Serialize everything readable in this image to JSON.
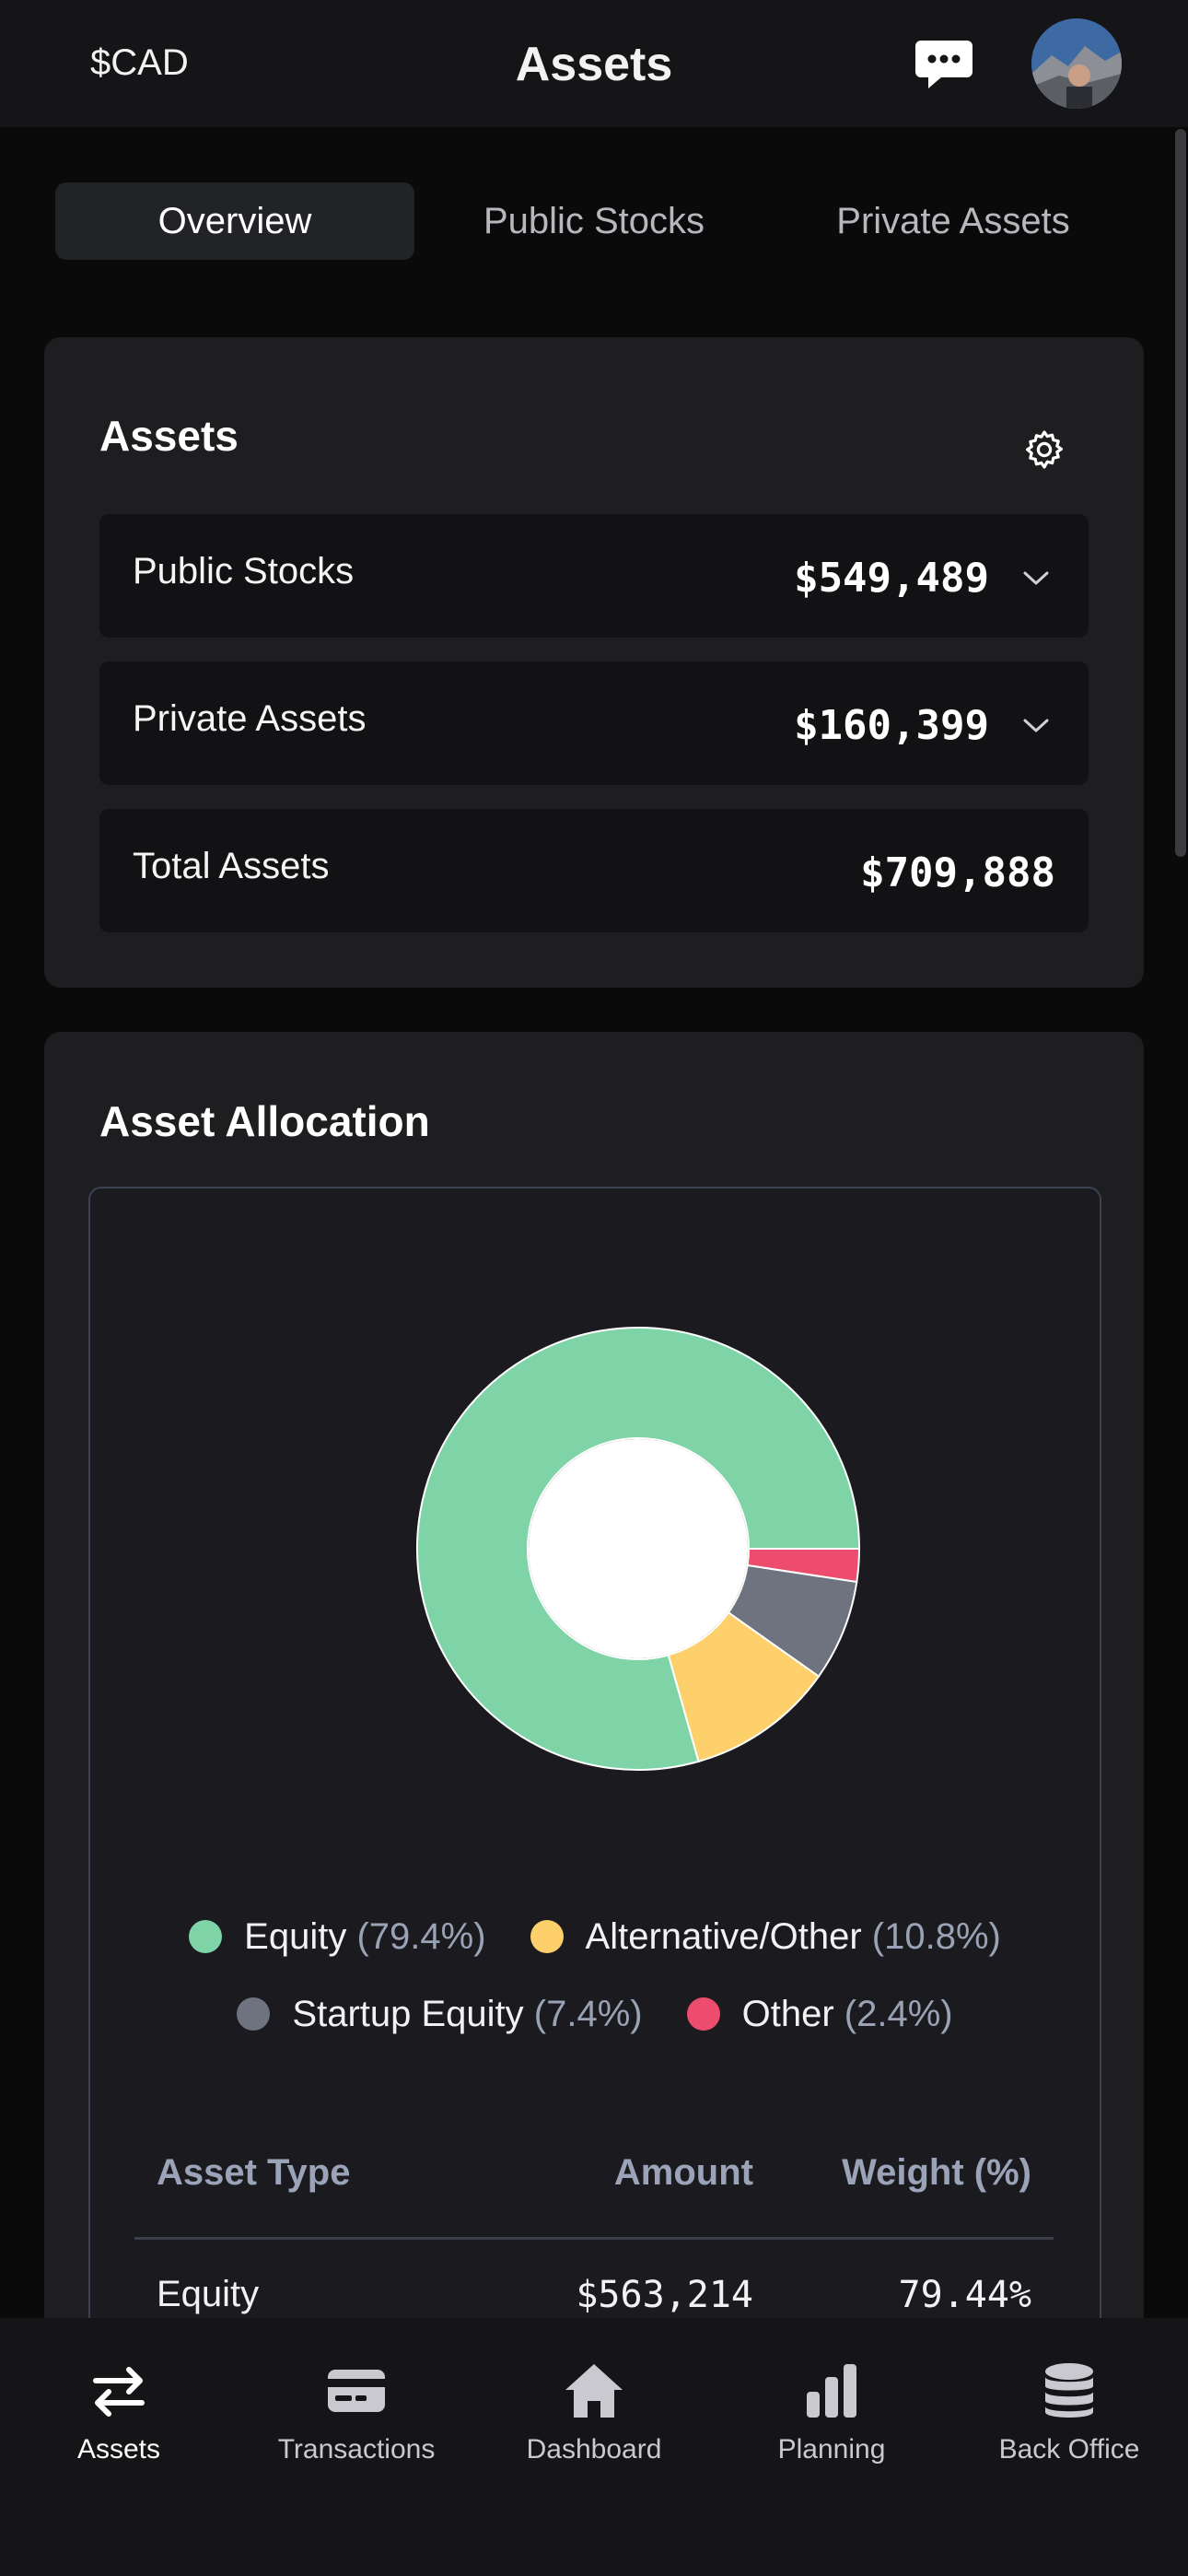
{
  "header": {
    "currency": "$CAD",
    "title": "Assets"
  },
  "tabs": [
    {
      "label": "Overview",
      "active": true
    },
    {
      "label": "Public Stocks",
      "active": false
    },
    {
      "label": "Private Assets",
      "active": false
    }
  ],
  "assets_card": {
    "title": "Assets",
    "rows": [
      {
        "label": "Public Stocks",
        "value": "$549,489",
        "expandable": true
      },
      {
        "label": "Private Assets",
        "value": "$160,399",
        "expandable": true
      },
      {
        "label": "Total Assets",
        "value": "$709,888",
        "expandable": false
      }
    ]
  },
  "allocation_card": {
    "title": "Asset Allocation",
    "legend": [
      {
        "label": "Equity",
        "pct": "(79.4%)",
        "color": "#7ed3a7"
      },
      {
        "label": "Alternative/Other",
        "pct": "(10.8%)",
        "color": "#fdd06b"
      },
      {
        "label": "Startup Equity",
        "pct": "(7.4%)",
        "color": "#6f7380"
      },
      {
        "label": "Other",
        "pct": "(2.4%)",
        "color": "#ee4c6e"
      }
    ],
    "table": {
      "headers": [
        "Asset Type",
        "Amount",
        "Weight (%)"
      ],
      "rows": [
        {
          "type": "Equity",
          "amount": "$563,214",
          "weight": "79.44%"
        }
      ]
    }
  },
  "chart_data": {
    "type": "pie",
    "donut": true,
    "categories": [
      "Equity",
      "Alternative/Other",
      "Startup Equity",
      "Other"
    ],
    "values": [
      79.4,
      10.8,
      7.4,
      2.4
    ],
    "colors": [
      "#7ed3a7",
      "#fdd06b",
      "#6f7380",
      "#ee4c6e"
    ]
  },
  "bottom_nav": [
    {
      "label": "Assets",
      "icon": "arrows-exchange-icon",
      "active": true
    },
    {
      "label": "Transactions",
      "icon": "credit-card-icon",
      "active": false
    },
    {
      "label": "Dashboard",
      "icon": "home-icon",
      "active": false
    },
    {
      "label": "Planning",
      "icon": "bar-chart-icon",
      "active": false
    },
    {
      "label": "Back Office",
      "icon": "database-icon",
      "active": false
    }
  ]
}
